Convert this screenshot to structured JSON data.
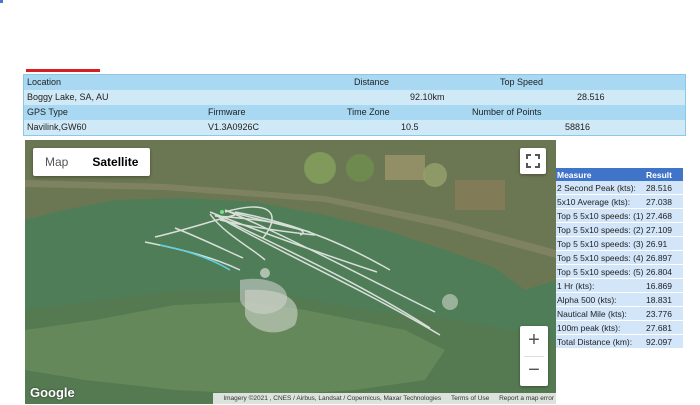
{
  "info": {
    "headers1": {
      "location": "Location",
      "distance": "Distance",
      "top_speed": "Top Speed"
    },
    "values1": {
      "location": "Boggy Lake, SA, AU",
      "distance": "92.10km",
      "top_speed": "28.516"
    },
    "headers2": {
      "gps_type": "GPS Type",
      "firmware": "Firmware",
      "time_zone": "Time Zone",
      "points": "Number of Points"
    },
    "values2": {
      "gps_type": "Navilink,GW60",
      "firmware": "V1.3A0926C",
      "time_zone": "10.5",
      "points": "58816"
    }
  },
  "map": {
    "type_buttons": [
      "Map",
      "Satellite"
    ],
    "selected": "Satellite",
    "logo": "Google",
    "attribution": "Imagery ©2021 , CNES / Airbus, Landsat / Copernicus, Maxar Technologies",
    "links": [
      "Terms of Use",
      "Report a map error"
    ],
    "zoom_in": "+",
    "zoom_out": "−",
    "colors": {
      "water": "#4e7f57",
      "land": "#6f7a52",
      "track": "#e6e8e6",
      "track_start": "#5fd0e0"
    }
  },
  "results": {
    "headers": [
      "Measure",
      "Result"
    ],
    "rows": [
      [
        "2 Second Peak (kts):",
        "28.516"
      ],
      [
        "5x10 Average (kts):",
        "27.038"
      ],
      [
        "Top 5 5x10 speeds: (1)",
        "27.468"
      ],
      [
        "Top 5 5x10 speeds: (2)",
        "27.109"
      ],
      [
        "Top 5 5x10 speeds: (3)",
        "26.91"
      ],
      [
        "Top 5 5x10 speeds: (4)",
        "26.897"
      ],
      [
        "Top 5 5x10 speeds: (5)",
        "26.804"
      ],
      [
        "1 Hr (kts):",
        "16.869"
      ],
      [
        "Alpha 500 (kts):",
        "18.831"
      ],
      [
        "Nautical Mile (kts):",
        "23.776"
      ],
      [
        "100m peak (kts):",
        "27.681"
      ],
      [
        "Total Distance (km):",
        "92.097"
      ]
    ]
  }
}
